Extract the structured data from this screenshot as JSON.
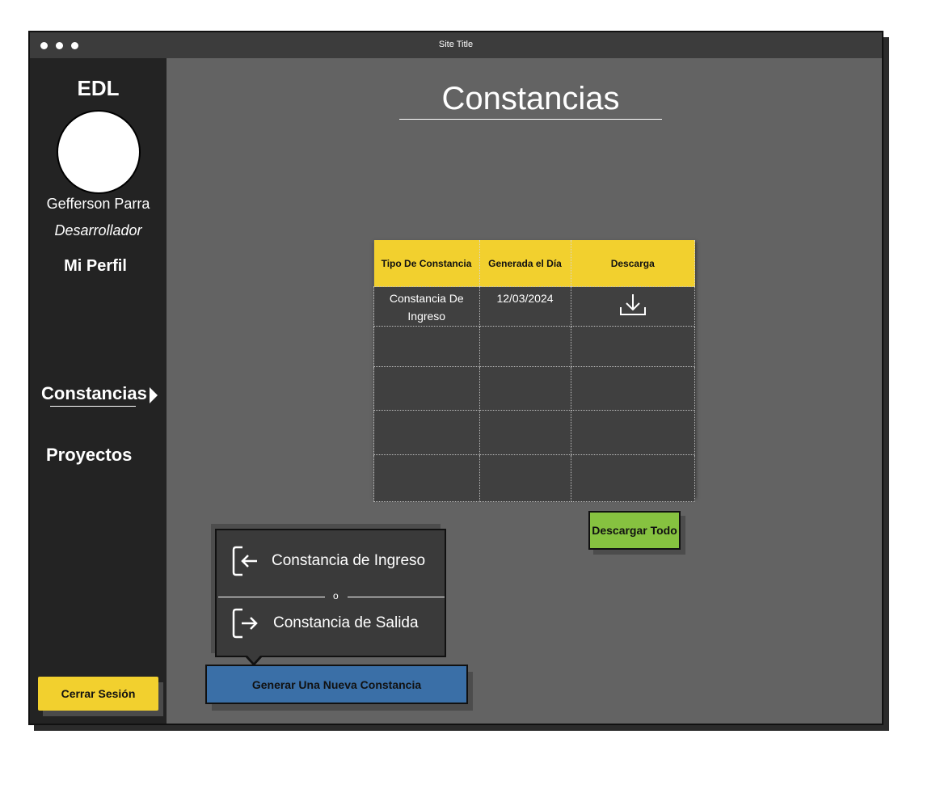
{
  "window": {
    "title": "Site Title"
  },
  "sidebar": {
    "brand": "EDL",
    "user_name": "Gefferson Parra",
    "user_role": "Desarrollador",
    "profile_link": "Mi Perfil",
    "nav_items": [
      {
        "label": "Constancias",
        "active": true
      },
      {
        "label": "Proyectos",
        "active": false
      }
    ],
    "logout_label": "Cerrar Sesión"
  },
  "main": {
    "title": "Constancias",
    "table": {
      "headers": [
        "Tipo De Constancia",
        "Generada el Día",
        "Descarga"
      ],
      "rows": [
        {
          "tipo": "Constancia De Ingreso",
          "fecha": "12/03/2024",
          "download_icon": "download-icon"
        }
      ]
    },
    "download_all_label": "Descargar Todo",
    "popup": {
      "option_in": "Constancia de Ingreso",
      "separator": "o",
      "option_out": "Constancia de Salida"
    },
    "generate_label": "Generar Una Nueva Constancia"
  },
  "colors": {
    "accent_yellow": "#f2d02e",
    "accent_green": "#86c240",
    "accent_blue": "#3a6fa7",
    "sidebar_bg": "#232323",
    "content_bg": "#636363"
  }
}
